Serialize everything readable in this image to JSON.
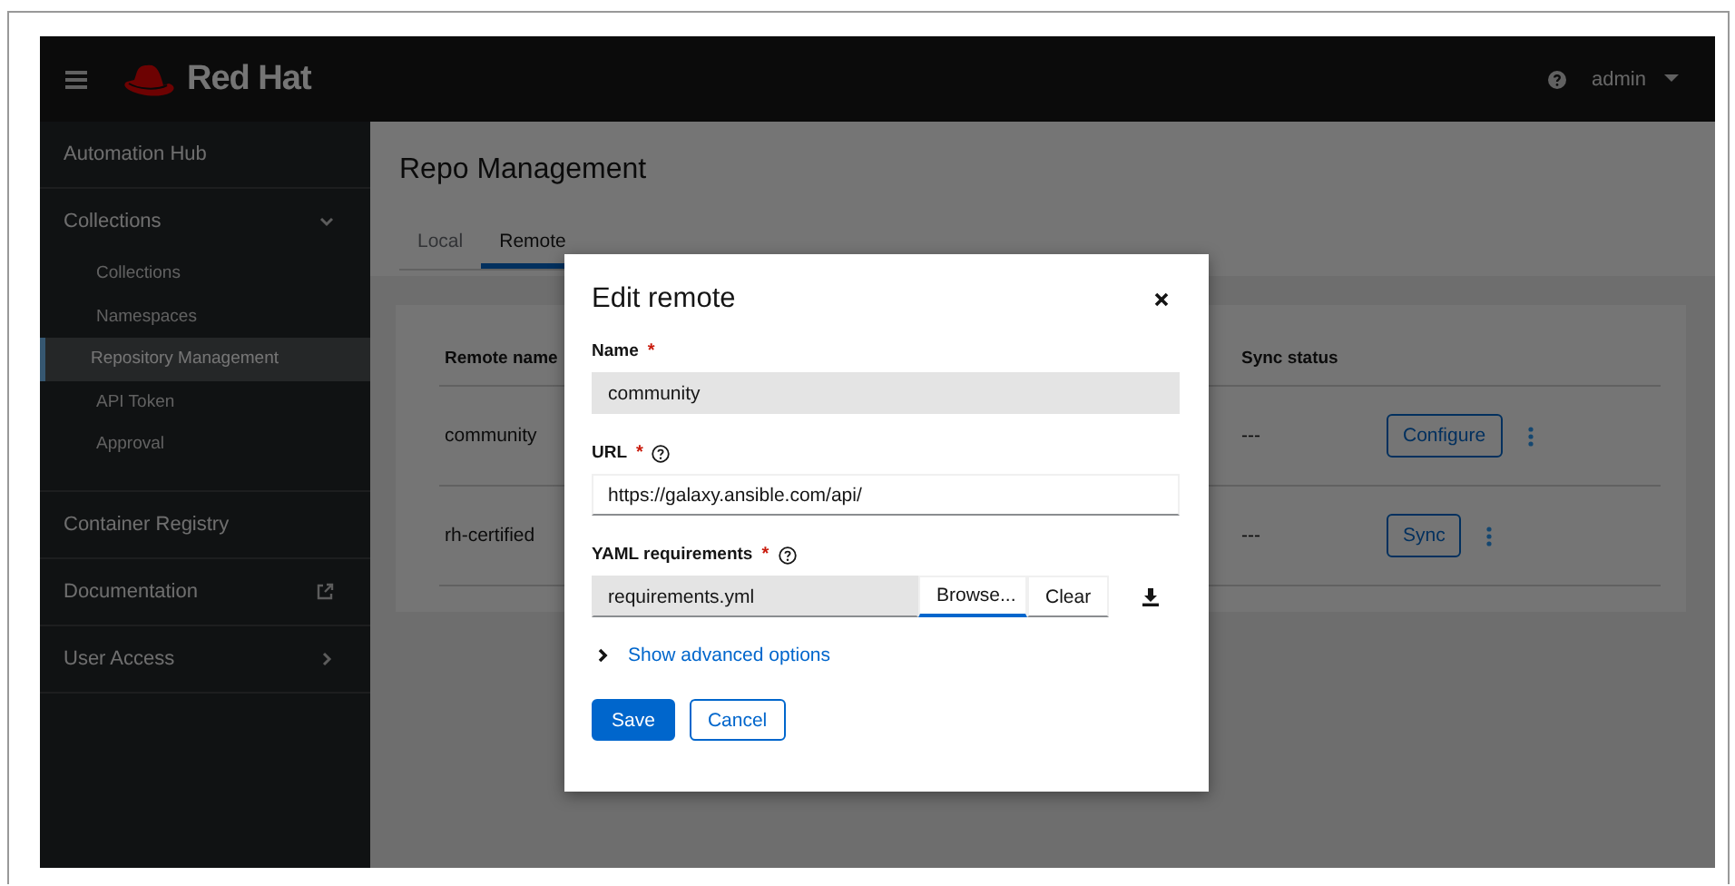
{
  "header": {
    "brand": "Red Hat",
    "user": "admin"
  },
  "sidebar": {
    "items": [
      {
        "label": "Automation Hub",
        "kind": "link"
      },
      {
        "label": "Collections",
        "kind": "group",
        "expanded": true,
        "children": [
          {
            "label": "Collections",
            "selected": false
          },
          {
            "label": "Namespaces",
            "selected": false
          },
          {
            "label": "Repository Management",
            "selected": true
          },
          {
            "label": "API Token",
            "selected": false
          },
          {
            "label": "Approval",
            "selected": false
          }
        ]
      },
      {
        "label": "Container Registry",
        "kind": "link"
      },
      {
        "label": "Documentation",
        "kind": "external"
      },
      {
        "label": "User Access",
        "kind": "group",
        "expanded": false
      }
    ]
  },
  "page": {
    "title": "Repo Management",
    "tabs": [
      {
        "label": "Local",
        "selected": false
      },
      {
        "label": "Remote",
        "selected": true
      }
    ],
    "table": {
      "columns": [
        "Remote name",
        "Sync status"
      ],
      "rows": [
        {
          "name": "community",
          "sync_status": "---",
          "action": "Configure"
        },
        {
          "name": "rh-certified",
          "sync_status": "---",
          "action": "Sync"
        }
      ]
    }
  },
  "modal": {
    "title": "Edit remote",
    "fields": [
      {
        "label": "Name",
        "required_mark": "*",
        "help": false,
        "kind": "text",
        "value": "community",
        "disabled": true
      },
      {
        "label": "URL",
        "required_mark": "*",
        "help": true,
        "kind": "text",
        "value": "https://galaxy.ansible.com/api/",
        "disabled": false
      },
      {
        "label": "YAML requirements",
        "required_mark": "*",
        "help": true,
        "kind": "file",
        "value": "requirements.yml",
        "browse": "Browse...",
        "clear": "Clear"
      }
    ],
    "expander": {
      "label": "Show advanced options",
      "expanded": false
    },
    "buttons": [
      {
        "label": "Save",
        "kind": "primary"
      },
      {
        "label": "Cancel",
        "kind": "secondary"
      }
    ]
  }
}
